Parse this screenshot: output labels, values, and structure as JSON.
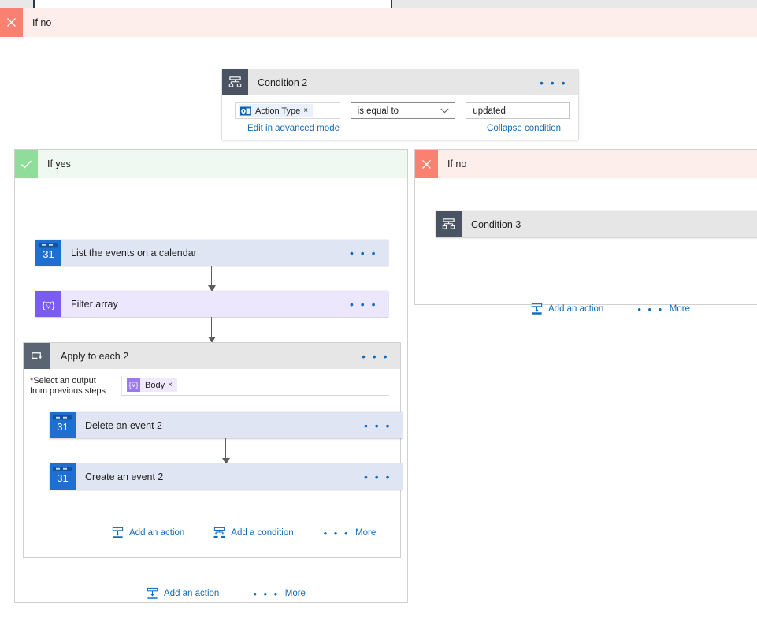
{
  "canvas": {
    "top_branch_band": {
      "label": "If no",
      "icon": "x-icon",
      "color": "#fdeeec",
      "icon_color": "#fa8072"
    }
  },
  "condition_card": {
    "title": "Condition 2",
    "icon": "condition-icon",
    "overflow_menu": "• • •",
    "left_operand": {
      "token_label": "Action Type",
      "token_icon": "outlook-icon",
      "remove": "×"
    },
    "operator": {
      "value": "is equal to",
      "chevron": "⌄"
    },
    "right_operand": {
      "value": "updated"
    },
    "advanced_link": "Edit in advanced mode",
    "collapse_link": "Collapse condition"
  },
  "branches": {
    "yes": {
      "label": "If yes",
      "icon": "check-icon",
      "header_color": "#eff9f1",
      "icon_color": "#8fdc9b",
      "actions": [
        {
          "title": "List the events on a calendar",
          "icon": "google-calendar-icon",
          "icon_text": "31",
          "menu": "• • •"
        },
        {
          "title": "Filter array",
          "icon": "filter-array-icon",
          "icon_text": "{∇}",
          "menu": "• • •"
        }
      ],
      "scope": {
        "title": "Apply to each 2",
        "icon": "loop-icon",
        "menu": "• • •",
        "field_label_line1": "Select an output",
        "field_label_line2": "from previous steps",
        "required_marker": "*",
        "token": {
          "label": "Body",
          "icon": "expression-icon",
          "remove": "×"
        },
        "actions": [
          {
            "title": "Delete an event 2",
            "icon": "google-calendar-icon",
            "icon_text": "31",
            "menu": "• • •"
          },
          {
            "title": "Create an event 2",
            "icon": "google-calendar-icon",
            "icon_text": "31",
            "menu": "• • •"
          }
        ],
        "footer": {
          "add_action": "Add an action",
          "add_condition": "Add a condition",
          "more": "More",
          "more_dots": "• • •"
        }
      },
      "footer": {
        "add_action": "Add an action",
        "more": "More",
        "more_dots": "• • •"
      }
    },
    "no": {
      "label": "If no",
      "icon": "x-icon",
      "header_color": "#fdeeec",
      "icon_color": "#fa8072",
      "condition": {
        "title": "Condition 3",
        "icon": "condition-icon"
      },
      "footer": {
        "add_action": "Add an action",
        "more": "More",
        "more_dots": "• • •"
      }
    }
  },
  "colors": {
    "link": "#0f6cbd",
    "action_card_bg": "#dfe5f2",
    "data_op_bg": "#ece7fd",
    "header_gray": "#e6e6e6",
    "icon_slate": "#4a5361"
  }
}
